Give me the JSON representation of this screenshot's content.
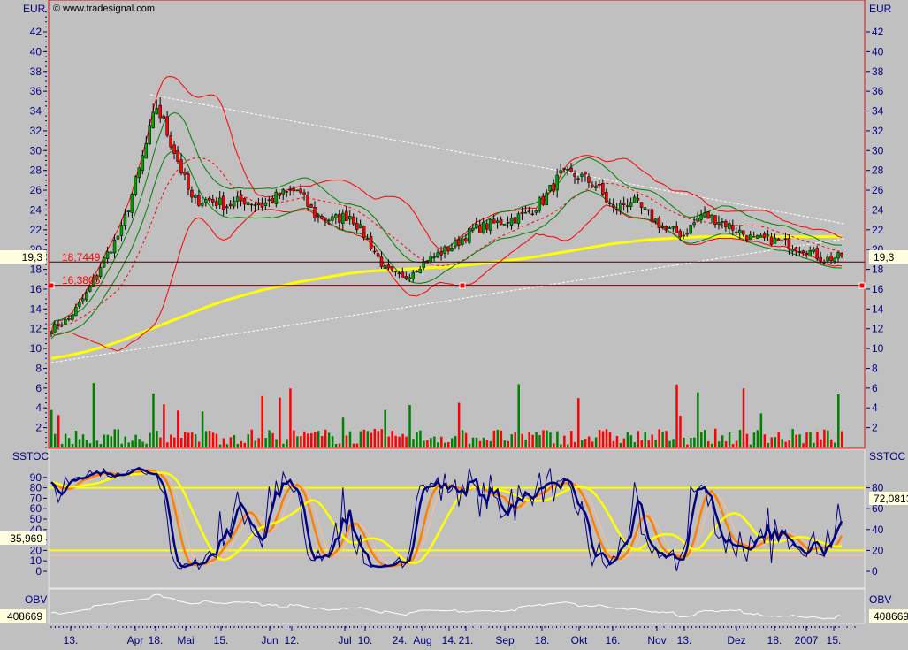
{
  "copyright": "© www.tradesignal.com",
  "currency_left": "EUR",
  "currency_right": "EUR",
  "price_ticks": [
    2,
    4,
    6,
    8,
    10,
    12,
    14,
    16,
    18,
    20,
    22,
    24,
    26,
    28,
    30,
    32,
    34,
    36,
    38,
    40,
    42
  ],
  "sstoc_label": "SSTOC",
  "sstoc_ticks": [
    0,
    10,
    20,
    30,
    40,
    50,
    60,
    70,
    80,
    90
  ],
  "sstoc_ticks_right": [
    0,
    20,
    40,
    60,
    80
  ],
  "obv_label": "OBV",
  "last_price_left": "19,3",
  "last_price_right": "19,3",
  "sstoc_value_left": "35,969",
  "sstoc_value_right": "72,0813",
  "obv_value_left": "408669",
  "obv_value_right": "408669",
  "level_upper_label": "18,7449",
  "level_lower_label": "16,3805",
  "x_labels": [
    "13.",
    "Apr",
    "18.",
    "Mai",
    "15.",
    "Jun",
    "12.",
    "Jul",
    "10.",
    "24.",
    "Aug",
    "14.",
    "21.",
    "Sep",
    "18.",
    "Okt",
    "16.",
    "Nov",
    "13.",
    "Dez",
    "18.",
    "2007",
    "15."
  ],
  "colors": {
    "axis_text": "#000080",
    "up": "#00a000",
    "down": "#ff0000",
    "bollinger": "#ff0000",
    "envelope": "#008000",
    "ma": "#ffff00",
    "stoch_fast": "#000080",
    "stoch_slow": "#ff8000"
  },
  "chart_data": {
    "type": "candlestick",
    "title": "",
    "ylabel": "EUR",
    "ylim": [
      0,
      44
    ],
    "weekly_close": [
      12,
      13,
      15.5,
      19,
      22,
      28,
      34.5,
      30,
      25,
      25,
      24.5,
      25,
      24.5,
      25.5,
      26,
      23.5,
      23,
      23.5,
      21,
      18,
      17,
      18.5,
      19.5,
      20.5,
      22,
      22.5,
      23,
      23.5,
      25,
      27.5,
      27.5,
      26.5,
      24,
      25,
      23.5,
      22,
      21.5,
      23.5,
      23,
      22,
      21,
      21,
      20.5,
      20,
      19,
      19.3
    ],
    "moving_average_weekly": [
      9,
      9.3,
      9.7,
      10.2,
      10.8,
      11.5,
      12.2,
      12.9,
      13.6,
      14.3,
      14.9,
      15.4,
      15.9,
      16.3,
      16.7,
      17,
      17.3,
      17.6,
      17.8,
      17.9,
      18,
      18.1,
      18.2,
      18.3,
      18.5,
      18.7,
      18.9,
      19.1,
      19.4,
      19.7,
      20,
      20.3,
      20.6,
      20.8,
      21,
      21.1,
      21.2,
      21.3,
      21.3,
      21.3,
      21.3,
      21.3,
      21.3,
      21.3,
      21.3,
      21.3
    ],
    "horizontal_levels": [
      18.7449,
      16.3805
    ],
    "sstoc_levels": [
      80,
      20
    ],
    "last_price": 19.3
  }
}
